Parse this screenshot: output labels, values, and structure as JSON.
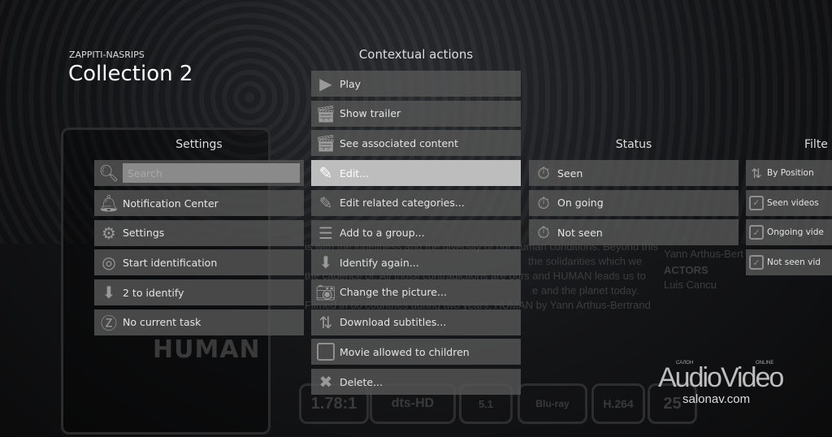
{
  "header": {
    "brand": "ZAPPITI-NASRIPS",
    "title": "Collection 2"
  },
  "background": {
    "poster_title": "HUMAN",
    "synopsis_lines": [
      "is with the loneliness and the diversity of our human conditions. Beyond this",
      "the solidarities which we",
      "the cadence of. All those contradictions are ours and HUMAN leads us to",
      "e and the planet today.",
      "Filmed in 60 countries during two years, HUMAN by Yann Arthus-Bertrand"
    ],
    "credits": [
      "Yann Arthus-Bert",
      "ACTORS",
      "Luis Cancu"
    ],
    "badges": [
      "1.78:1",
      "dts-HD",
      "5.1",
      "Blu-ray",
      "H.264",
      "25"
    ]
  },
  "context_menu": {
    "heading": "Contextual actions",
    "items": [
      {
        "label": "Play",
        "icon": "play-icon"
      },
      {
        "label": "Show trailer",
        "icon": "clapper-icon"
      },
      {
        "label": "See associated content",
        "icon": "clapper-icon"
      },
      {
        "label": "Edit...",
        "icon": "pencil-icon",
        "selected": true
      },
      {
        "label": "Edit related categories...",
        "icon": "pencil-icon"
      },
      {
        "label": "Add to a group...",
        "icon": "list-icon"
      },
      {
        "label": "Identify again...",
        "icon": "identify-icon"
      },
      {
        "label": "Change the picture...",
        "icon": "camera-icon"
      },
      {
        "label": "Download subtitles...",
        "icon": "download-subtitles-icon"
      },
      {
        "label": "Movie allowed to children",
        "icon": "checkbox-icon"
      },
      {
        "label": "Delete...",
        "icon": "delete-icon"
      }
    ]
  },
  "settings_menu": {
    "heading": "Settings",
    "search_placeholder": "Search",
    "items": [
      {
        "label": "Notification Center",
        "icon": "bell-icon"
      },
      {
        "label": "Settings",
        "icon": "gear-icon"
      },
      {
        "label": "Start identification",
        "icon": "target-icon"
      },
      {
        "label": "2 to identify",
        "icon": "arrow-down-icon"
      },
      {
        "label": "No current task",
        "icon": "zappiti-icon"
      }
    ]
  },
  "status_menu": {
    "heading": "Status",
    "items": [
      {
        "label": "Seen",
        "icon": "stopwatch-icon"
      },
      {
        "label": "On going",
        "icon": "stopwatch-icon"
      },
      {
        "label": "Not seen",
        "icon": "stopwatch-icon"
      }
    ]
  },
  "filter_menu": {
    "heading": "Filte",
    "items": [
      {
        "label": "By Position",
        "icon": "sort-icon"
      },
      {
        "label": "Seen videos",
        "icon": "checkbox-checked-icon",
        "checked": true
      },
      {
        "label": "Ongoing vide",
        "icon": "checkbox-checked-icon",
        "checked": true
      },
      {
        "label": "Not seen vid",
        "icon": "checkbox-checked-icon",
        "checked": true
      }
    ]
  },
  "watermark": {
    "name": "AudioVideo",
    "top_left": "САЛОН",
    "top_right": "ONLINE",
    "site": "salonav.com"
  }
}
